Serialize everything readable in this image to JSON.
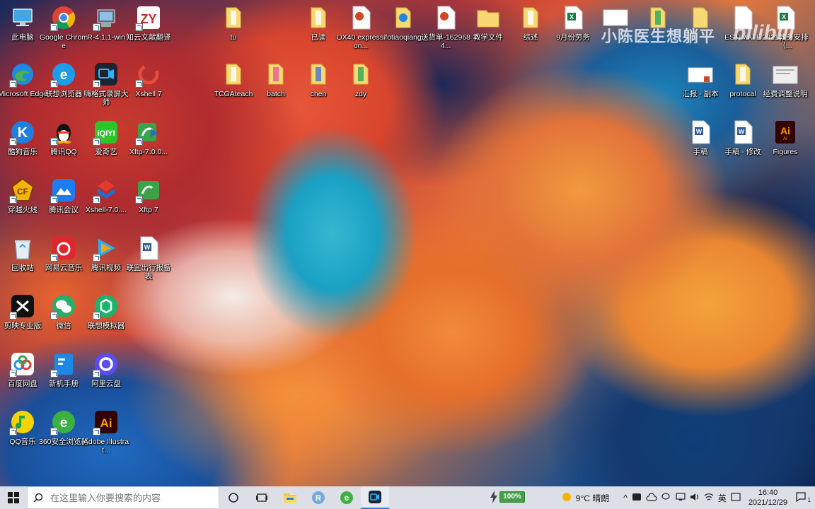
{
  "desktop": {
    "col1": [
      "此电脑",
      "Microsoft Edge",
      "酷狗音乐",
      "穿越火线",
      "回收站",
      "剪映专业版",
      "百度网盘",
      "QQ音乐"
    ],
    "col2": [
      "Google Chrome",
      "联想浏览器",
      "腾讯QQ",
      "腾讯会议",
      "网易云音乐",
      "微信",
      "新机手册",
      "360安全浏览器"
    ],
    "col3": [
      "R-4.1.1-win",
      "嗨格式录屏大师",
      "爱奇艺",
      "Xshell-7.0....",
      "腾讯视频",
      "联想模拟器",
      "阿里云盘",
      "Adobe Illustrat..."
    ],
    "col4": [
      "知云文献翻译",
      "Xshell 7",
      "Xftp-7.0.0...",
      "Xftp 7",
      "联宜出行报备表"
    ],
    "top_row": [
      "tu",
      "已读",
      "OX40 expression...",
      "fotiaoqiang",
      "送货单-1629684...",
      "教学文件",
      "综述",
      "9月份劳务"
    ],
    "row2": [
      "TCGAteach",
      "batch",
      "chen",
      "zdy"
    ],
    "right_top": [
      "",
      "",
      "",
      "ESTIMATE",
      "2021教务安排（..."
    ],
    "right_row2": [
      "汇报 - 副本",
      "protocal",
      "经费调整说明"
    ],
    "right_row3": [
      "手稿",
      "手稿 - 修改",
      "Figures"
    ],
    "watermark": "小陈医生想躺平",
    "bili_logo": "bilibili"
  },
  "taskbar": {
    "search_placeholder": "在这里输入你要搜索的内容",
    "battery": "100%",
    "weather": "9°C 晴朗",
    "lang": "英",
    "time": "16:40",
    "date": "2021/12/29",
    "notif_count": "1"
  }
}
